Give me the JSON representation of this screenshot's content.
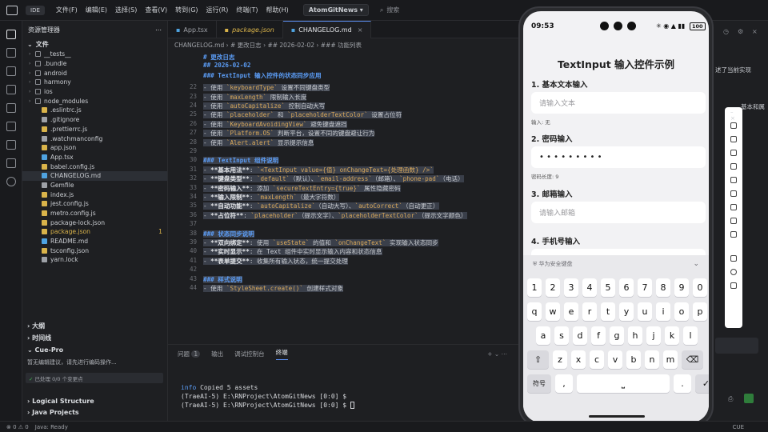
{
  "titlebar": {
    "ide_label": "IDE",
    "menus": [
      "文件(F)",
      "编辑(E)",
      "选择(S)",
      "查看(V)",
      "转到(G)",
      "运行(R)",
      "终端(T)",
      "帮助(H)"
    ],
    "project": "AtomGitNews",
    "search_placeholder": "搜索"
  },
  "explorer": {
    "title": "资源管理器",
    "section": "文件",
    "items": [
      {
        "name": "__tests__",
        "type": "folder"
      },
      {
        "name": ".bundle",
        "type": "folder"
      },
      {
        "name": "android",
        "type": "folder"
      },
      {
        "name": "harmony",
        "type": "folder"
      },
      {
        "name": "ios",
        "type": "folder"
      },
      {
        "name": "node_modules",
        "type": "folder"
      },
      {
        "name": ".eslintrc.js",
        "type": "file"
      },
      {
        "name": ".gitignore",
        "type": "file"
      },
      {
        "name": ".prettierrc.js",
        "type": "file"
      },
      {
        "name": ".watchmanconfig",
        "type": "file"
      },
      {
        "name": "app.json",
        "type": "file"
      },
      {
        "name": "App.tsx",
        "type": "file"
      },
      {
        "name": "babel.config.js",
        "type": "file"
      },
      {
        "name": "CHANGELOG.md",
        "type": "file"
      },
      {
        "name": "Gemfile",
        "type": "file"
      },
      {
        "name": "index.js",
        "type": "file"
      },
      {
        "name": "jest.config.js",
        "type": "file"
      },
      {
        "name": "metro.config.js",
        "type": "file"
      },
      {
        "name": "package-lock.json",
        "type": "file"
      },
      {
        "name": "package.json",
        "type": "file"
      },
      {
        "name": "README.md",
        "type": "file"
      },
      {
        "name": "tsconfig.json",
        "type": "file"
      },
      {
        "name": "yarn.lock",
        "type": "file"
      }
    ],
    "package_json_badge": "1",
    "outline": "大纲",
    "timeline": "时间线",
    "cue_pro": "Cue-Pro",
    "cue_msg": "暂无编辑建议，请先进行编码操作...",
    "cue_done": "已处理 0/0 个变更点",
    "logical_structure": "Logical Structure",
    "java_projects": "Java Projects"
  },
  "tabs": [
    {
      "label": "App.tsx"
    },
    {
      "label": "package.json"
    },
    {
      "label": "CHANGELOG.md"
    }
  ],
  "breadcrumb": "CHANGELOG.md  › # 更改日志  › ## 2026-02-02  › ### 功能列表",
  "editor": {
    "header_lines": [
      "# 更改日志",
      "## 2026-02-02",
      "### TextInput 输入控件的状态同步应用"
    ],
    "lines": [
      {
        "n": "22",
        "text": "- 使用 `keyboardType` 设置不同键盘类型"
      },
      {
        "n": "23",
        "text": "- 使用 `maxLength` 限制输入长度"
      },
      {
        "n": "24",
        "text": "- 使用 `autoCapitalize` 控制自动大写"
      },
      {
        "n": "25",
        "text": "- 使用 `placeholder` 和 `placeholderTextColor` 设置占位符"
      },
      {
        "n": "26",
        "text": "- 使用 `KeyboardAvoidingView` 避免键盘遮挡"
      },
      {
        "n": "27",
        "text": "- 使用 `Platform.OS` 判断平台，设置不同的键盘避让行为"
      },
      {
        "n": "28",
        "text": "- 使用 `Alert.alert` 显示提示信息"
      },
      {
        "n": "29",
        "text": ""
      },
      {
        "n": "30",
        "text": "### TextInput 组件说明"
      },
      {
        "n": "31",
        "text": "- **基本用法**: `<TextInput value={值} onChangeText={处理函数} />`"
      },
      {
        "n": "32",
        "text": "- **键盘类型**: `default`（默认）、`email-address`（邮箱）、`phone-pad`（电话）"
      },
      {
        "n": "33",
        "text": "- **密码输入**: 添加 `secureTextEntry={true}` 属性隐藏密码"
      },
      {
        "n": "34",
        "text": "- **输入限制**: `maxLength`（最大字符数）"
      },
      {
        "n": "35",
        "text": "- **自动功能**: `autoCapitalize`（自动大写）、`autoCorrect`（自动更正）"
      },
      {
        "n": "36",
        "text": "- **占位符**: `placeholder`（提示文字）、`placeholderTextColor`（提示文字颜色）"
      },
      {
        "n": "37",
        "text": ""
      },
      {
        "n": "38",
        "text": "### 状态同步说明"
      },
      {
        "n": "39",
        "text": "- **双向绑定**: 使用 `useState` 的值和 `onChangeText` 实现输入状态同步"
      },
      {
        "n": "40",
        "text": "- **实时显示**: 在 Text 组件中实时显示输入内容和状态信息"
      },
      {
        "n": "41",
        "text": "- **表单提交**: 收集所有输入状态，统一提交处理"
      },
      {
        "n": "42",
        "text": ""
      },
      {
        "n": "43",
        "text": "### 样式说明"
      },
      {
        "n": "44",
        "text": "- 使用 `StyleSheet.create()` 创建样式对象"
      }
    ]
  },
  "panel": {
    "tabs": [
      "问题",
      "输出",
      "调试控制台",
      "终端"
    ],
    "problems_badge": "1",
    "terminal": [
      "info Copied 5 assets",
      "(TraeAI-5) E:\\RNProject\\AtomGitNews [0:0] $",
      "(TraeAI-5) E:\\RNProject\\AtomGitNews [0:0] $"
    ]
  },
  "status": {
    "java": "Java: Ready",
    "errors": "0",
    "warnings": "0",
    "right1": "CUE"
  },
  "phone": {
    "time": "09:53",
    "battery": "100",
    "title": "TextInput 输入控件示例",
    "sections": [
      {
        "label": "1. 基本文本输入",
        "placeholder": "请输入文本",
        "hint": "输入: 无"
      },
      {
        "label": "2. 密码输入",
        "value": "• • • • • • • • •",
        "hint": "密码长度: 9"
      },
      {
        "label": "3. 邮箱输入",
        "placeholder": "请输入邮箱"
      },
      {
        "label": "4. 手机号输入"
      }
    ],
    "keyboard": {
      "brand": "华为安全键盘",
      "row1": [
        "1",
        "2",
        "3",
        "4",
        "5",
        "6",
        "7",
        "8",
        "9",
        "0"
      ],
      "row2": [
        "q",
        "w",
        "e",
        "r",
        "t",
        "y",
        "u",
        "i",
        "o",
        "p"
      ],
      "row3": [
        "a",
        "s",
        "d",
        "f",
        "g",
        "h",
        "j",
        "k",
        "l"
      ],
      "row4": [
        "z",
        "x",
        "c",
        "v",
        "b",
        "n",
        "m"
      ],
      "symbols": "符号",
      "comma": ",",
      "period": "."
    }
  },
  "right_snippets": [
    "述了当前实现",
    "基本和属"
  ]
}
